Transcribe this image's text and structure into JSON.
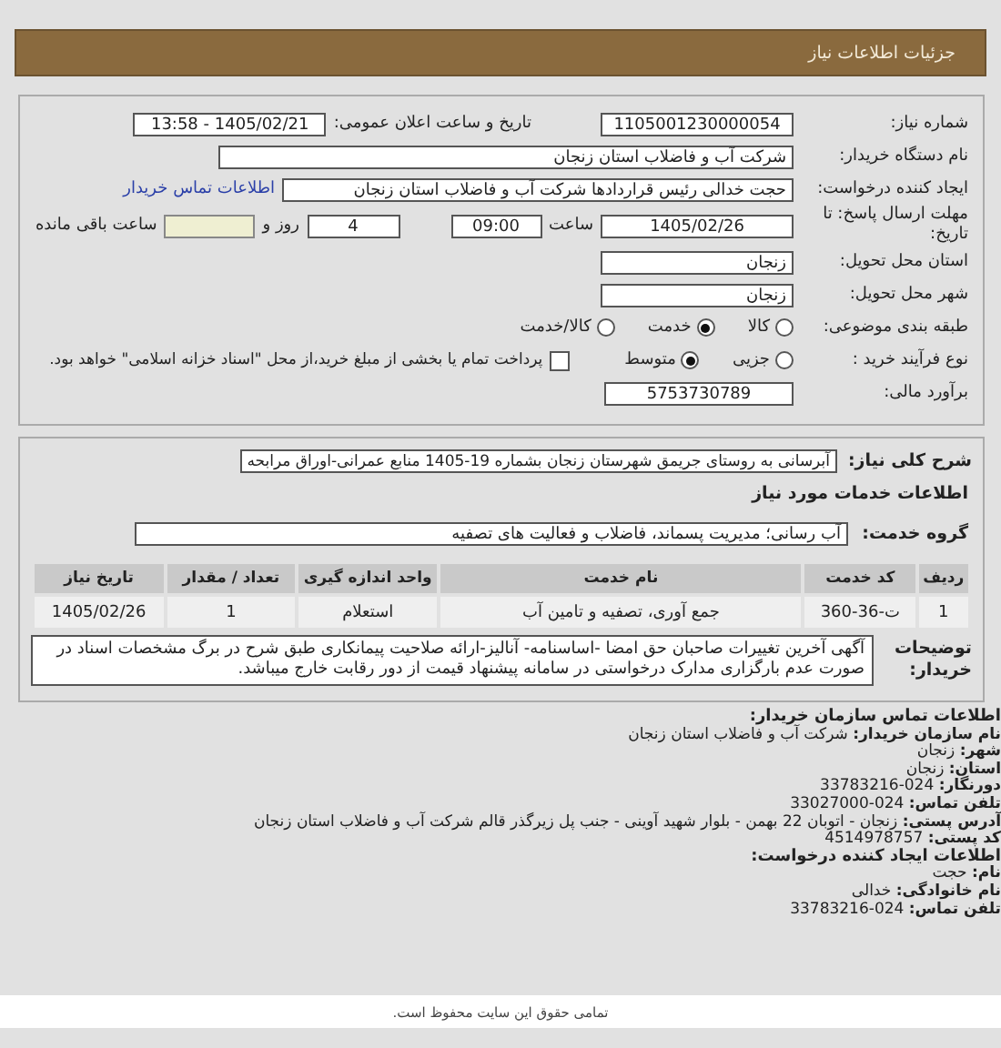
{
  "header": {
    "title": "جزئیات اطلاعات نیاز"
  },
  "form": {
    "need_number": {
      "label": "شماره نیاز:",
      "value": "1105001230000054"
    },
    "announce": {
      "label": "تاریخ و ساعت اعلان عمومی:",
      "value": "1405/02/21 - 13:58"
    },
    "buyer": {
      "label": "نام دستگاه خریدار:",
      "value": "شرکت آب و فاضلاب استان زنجان"
    },
    "requester": {
      "label": "ایجاد کننده درخواست:",
      "value": "حجت  خدالی رئیس قراردادها شرکت آب و فاضلاب استان زنجان",
      "link": "اطلاعات تماس خریدار"
    },
    "deadline": {
      "label": "مهلت ارسال پاسخ: تا تاریخ:",
      "date": "1405/02/26",
      "time_label": "ساعت",
      "time": "09:00",
      "days": "4",
      "days_label": "روز و",
      "remaining_label": "ساعت باقی مانده"
    },
    "province": {
      "label": "استان محل تحویل:",
      "value": "زنجان"
    },
    "city": {
      "label": "شهر محل تحویل:",
      "value": "زنجان"
    },
    "category": {
      "label": "طبقه بندی موضوعی:",
      "options": [
        {
          "label": "کالا",
          "selected": false
        },
        {
          "label": "خدمت",
          "selected": true
        },
        {
          "label": "کالا/خدمت",
          "selected": false
        }
      ]
    },
    "process": {
      "label": "نوع فرآیند خرید :",
      "options": [
        {
          "label": "جزیی",
          "selected": false
        },
        {
          "label": "متوسط",
          "selected": true
        }
      ],
      "treasury": {
        "label": "پرداخت تمام یا بخشی از مبلغ خرید،از محل \"اسناد خزانه اسلامی\" خواهد بود.",
        "checked": false
      }
    },
    "estimate": {
      "label": "برآورد مالی:",
      "value": "5753730789"
    }
  },
  "services": {
    "description": {
      "label": "شرح کلی نیاز:",
      "value": "آبرسانی به روستای جریمق شهرستان زنجان بشماره 19-1405 منابع عمرانی-اوراق مرابحه"
    },
    "section_title": "اطلاعات خدمات مورد نیاز",
    "group": {
      "label": "گروه خدمت:",
      "value": "آب رسانی؛ مدیریت پسماند، فاضلاب و فعالیت های تصفیه"
    },
    "table": {
      "columns": [
        "ردیف",
        "کد خدمت",
        "نام خدمت",
        "واحد اندازه گیری",
        "تعداد / مقدار",
        "تاریخ نیاز"
      ],
      "rows": [
        [
          "1",
          "ت-36-360",
          "جمع آوری، تصفیه و تامین آب",
          "استعلام",
          "1",
          "1405/02/26"
        ]
      ]
    },
    "notes": {
      "label": "توضیحات خریدار:",
      "value": "آگهی آخرین تغییرات صاحبان حق امضا -اساسنامه- آنالیز-ارائه صلاحیت پیمانکاری طبق شرح در برگ مشخصات اسناد در صورت عدم بارگزاری مدارک درخواستی در سامانه پیشنهاد قیمت از دور رقابت خارج میباشد."
    }
  },
  "contact": [
    {
      "kind": "heading",
      "label": "اطلاعات تماس سازمان خریدار:"
    },
    {
      "kind": "line",
      "label": "نام سازمان خریدار:",
      "value": "شرکت آب و فاضلاب استان زنجان"
    },
    {
      "kind": "line",
      "label": "شهر:",
      "value": "زنجان"
    },
    {
      "kind": "line",
      "label": "استان:",
      "value": "زنجان"
    },
    {
      "kind": "line",
      "label": "دورنگار:",
      "value": "024-33783216"
    },
    {
      "kind": "line",
      "label": "تلفن تماس:",
      "value": "024-33027000"
    },
    {
      "kind": "line",
      "label": "آدرس پستی:",
      "value": "زنجان - اتوبان 22 بهمن - بلوار شهید آوینی - جنب پل زیرگذر قالم شرکت آب و فاضلاب استان زنجان"
    },
    {
      "kind": "line",
      "label": "کد پستی:",
      "value": "4514978757"
    },
    {
      "kind": "heading",
      "label": "اطلاعات ایجاد کننده درخواست:"
    },
    {
      "kind": "line",
      "label": "نام:",
      "value": "حجت"
    },
    {
      "kind": "line",
      "label": "نام خانوادگی:",
      "value": "خدالی"
    },
    {
      "kind": "line",
      "label": "تلفن تماس:",
      "value": "024-33783216"
    }
  ],
  "footer": {
    "text": "تمامی حقوق این سایت محفوظ است."
  }
}
